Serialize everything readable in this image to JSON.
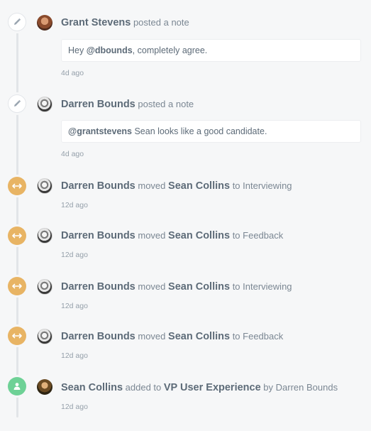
{
  "events": [
    {
      "type": "note",
      "icon": "pencil-icon",
      "actor": "Grant Stevens",
      "action": "posted a note",
      "note_mention": "@dbounds",
      "note_text": ", completely agree.",
      "note_prefix": "Hey ",
      "time": "4d ago"
    },
    {
      "type": "note",
      "icon": "pencil-icon",
      "actor": "Darren Bounds",
      "action": "posted a note",
      "note_prefix": "",
      "note_mention": "@grantstevens",
      "note_text": " Sean looks like a good candidate.",
      "time": "4d ago"
    },
    {
      "type": "move",
      "icon": "arrows-horizontal-icon",
      "actor": "Darren Bounds",
      "action": "moved",
      "subject": "Sean Collins",
      "connector": "to",
      "target": "Interviewing",
      "time": "12d ago"
    },
    {
      "type": "move",
      "icon": "arrows-horizontal-icon",
      "actor": "Darren Bounds",
      "action": "moved",
      "subject": "Sean Collins",
      "connector": "to",
      "target": "Feedback",
      "time": "12d ago"
    },
    {
      "type": "move",
      "icon": "arrows-horizontal-icon",
      "actor": "Darren Bounds",
      "action": "moved",
      "subject": "Sean Collins",
      "connector": "to",
      "target": "Interviewing",
      "time": "12d ago"
    },
    {
      "type": "move",
      "icon": "arrows-horizontal-icon",
      "actor": "Darren Bounds",
      "action": "moved",
      "subject": "Sean Collins",
      "connector": "to",
      "target": "Feedback",
      "time": "12d ago"
    },
    {
      "type": "added",
      "icon": "person-icon",
      "actor": "Sean Collins",
      "action": "added to",
      "subject": "VP User Experience",
      "connector": "by",
      "target": "Darren Bounds",
      "time": "12d ago"
    }
  ],
  "colors": {
    "move": "#e8b464",
    "added": "#6ed196",
    "note_node": "#ffffff",
    "spine": "#e2e5e8",
    "background": "#f6f7f8"
  }
}
